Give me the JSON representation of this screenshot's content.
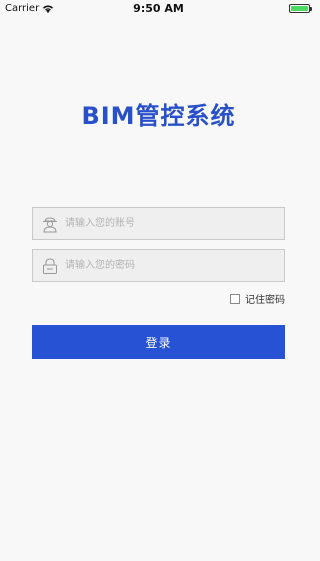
{
  "status_bar": {
    "carrier": "Carrier",
    "time": "9:50 AM",
    "icons": [
      "wifi-icon",
      "battery-icon"
    ]
  },
  "app": {
    "title": "BIM管控系统"
  },
  "login_form": {
    "account_placeholder": "请输入您的账号",
    "account_value": "",
    "password_placeholder": "请输入您的密码",
    "password_value": "",
    "remember_label": "记住密码",
    "remember_checked": false,
    "submit_label": "登录",
    "account_icon": "user-icon",
    "password_icon": "lock-icon"
  },
  "colors": {
    "accent": "#2752d4",
    "title": "#2850c8",
    "battery": "#4cd964"
  }
}
